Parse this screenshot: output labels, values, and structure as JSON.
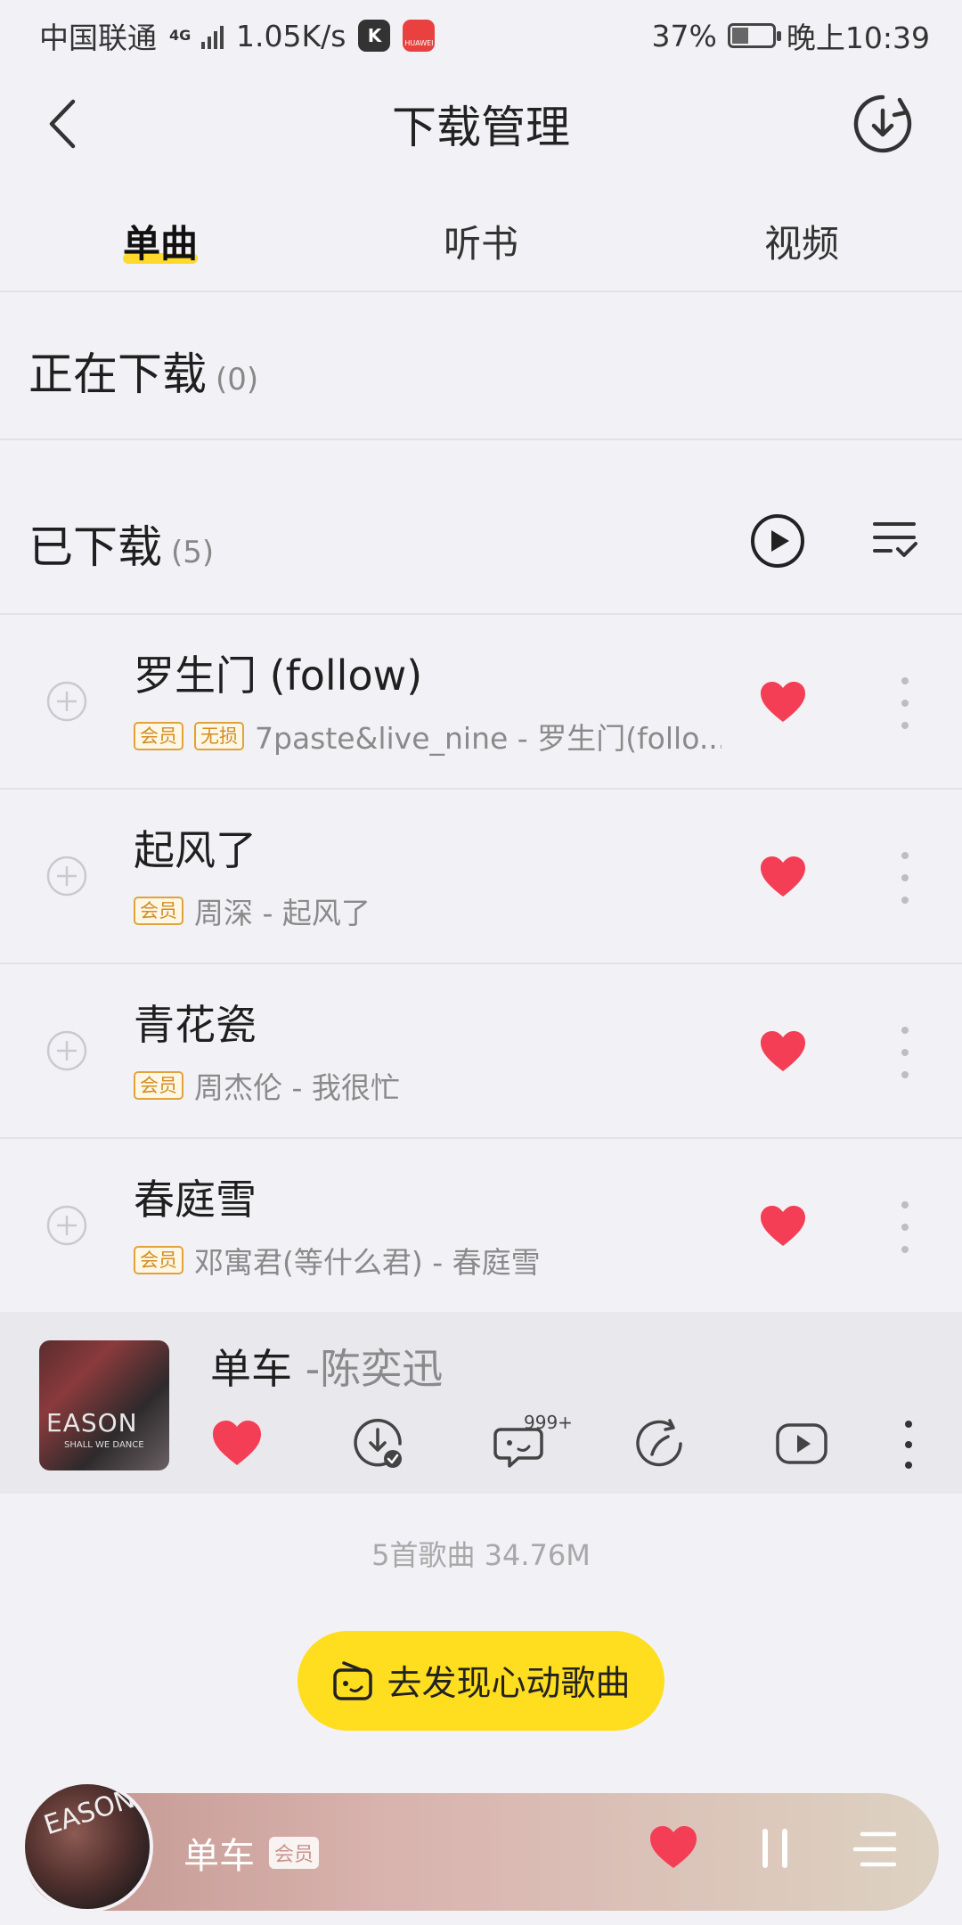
{
  "status_bar": {
    "carrier": "中国联通",
    "network": "4G",
    "speed": "1.05K/s",
    "app_icon_1": "K",
    "app_icon_2": "HUAWEI",
    "battery": "37%",
    "battery_level": 0.37,
    "time": "晚上10:39"
  },
  "header": {
    "title": "下载管理",
    "back_icon": "back-chevron-icon",
    "action_icon": "download-circle-icon"
  },
  "tabs": [
    {
      "label": "单曲",
      "active": true
    },
    {
      "label": "听书",
      "active": false
    },
    {
      "label": "视频",
      "active": false
    }
  ],
  "downloading": {
    "label": "正在下载",
    "count": "(0)"
  },
  "downloaded": {
    "label": "已下载",
    "count": "(5)",
    "play_all_icon": "play-circle-icon",
    "select_icon": "checklist-icon"
  },
  "songs": [
    {
      "title": "罗生门 (follow)",
      "badges": [
        "会员",
        "无损"
      ],
      "subtitle": "7paste&live_nine - 罗生门(follo...",
      "liked": true
    },
    {
      "title": "起风了",
      "badges": [
        "会员"
      ],
      "subtitle": "周深 - 起风了",
      "liked": true
    },
    {
      "title": "青花瓷",
      "badges": [
        "会员"
      ],
      "subtitle": "周杰伦 - 我很忙",
      "liked": true
    },
    {
      "title": "春庭雪",
      "badges": [
        "会员"
      ],
      "subtitle": "邓寓君(等什么君) - 春庭雪",
      "liked": true
    }
  ],
  "now_playing_card": {
    "title": "单车",
    "artist": "-陈奕迅",
    "cover_text": "EASON",
    "cover_sub": "SHALL WE DANCE",
    "comment_count": "999+"
  },
  "summary": "5首歌曲 34.76M",
  "discover_button": {
    "label": "去发现心动歌曲"
  },
  "player_bar": {
    "avatar_text": "EASON",
    "title": "单车",
    "badge": "会员"
  },
  "colors": {
    "accent": "#ffdd1f",
    "heart": "#f43e55",
    "background": "#f2f2f6"
  }
}
